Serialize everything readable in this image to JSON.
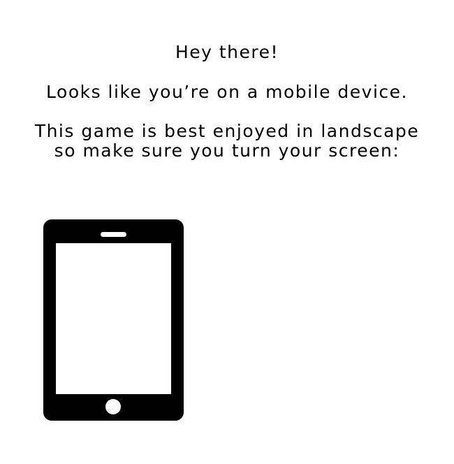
{
  "message": {
    "greeting": "Hey there!",
    "mobile_notice": "Looks like you’re on a mobile device.",
    "landscape_hint_line1": "This game is best enjoyed in landscape",
    "landscape_hint_line2": "so make sure you turn your screen:"
  },
  "illustration": {
    "icon": "phone-portrait-icon",
    "color": "#000000"
  }
}
